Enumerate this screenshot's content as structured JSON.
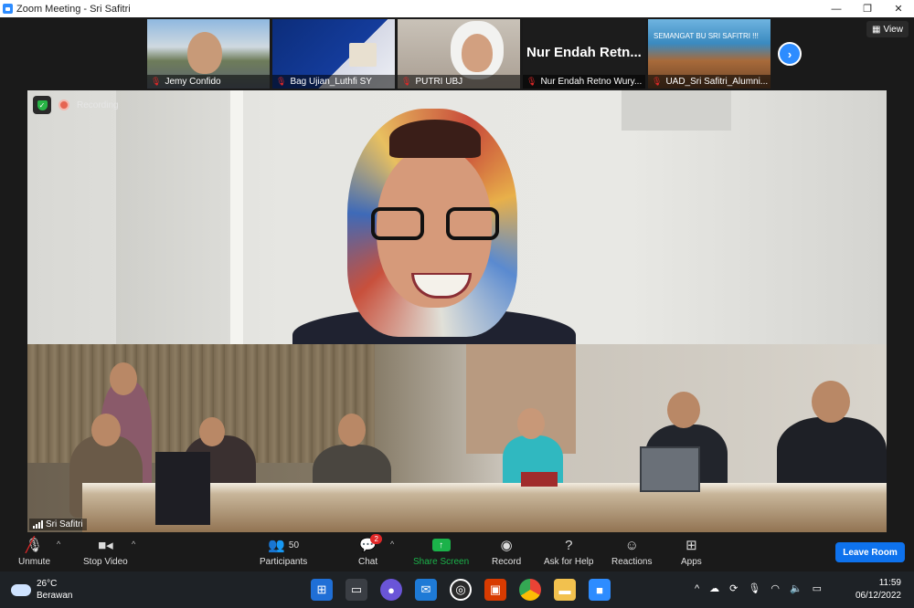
{
  "window": {
    "title": "Zoom Meeting - Sri Safitri",
    "minimize": "—",
    "restore": "❐",
    "close": "✕"
  },
  "view_button": {
    "label": "View",
    "icon": "grid-icon"
  },
  "thumbnails": [
    {
      "name": "Jemy Confido",
      "muted": true
    },
    {
      "name": "Bag Ujian_Luthfi SY",
      "muted": true
    },
    {
      "name": "PUTRI UBJ",
      "muted": true
    },
    {
      "name": "Nur Endah Retno Wury...",
      "muted": true,
      "big_name": "Nur Endah Retn..."
    },
    {
      "name": "UAD_Sri Safitri_Alumni...",
      "muted": true,
      "banner": "SEMANGAT BU SRI SAFITRI !!!"
    }
  ],
  "main_video": {
    "recording_label": "Recording",
    "speaker": "Sri Safitri"
  },
  "toolbar": {
    "unmute": "Unmute",
    "stop_video": "Stop Video",
    "participants": "Participants",
    "participants_count": "50",
    "chat": "Chat",
    "chat_badge": "2",
    "share_screen": "Share Screen",
    "record": "Record",
    "ask_for_help": "Ask for Help",
    "reactions": "Reactions",
    "apps": "Apps",
    "leave_room": "Leave Room"
  },
  "taskbar": {
    "temperature": "26°C",
    "weather": "Berawan",
    "time": "11:59",
    "date": "06/12/2022"
  },
  "colors": {
    "accent_blue": "#0e72ed",
    "share_green": "#1bb24a",
    "muted_red": "#e02828"
  }
}
